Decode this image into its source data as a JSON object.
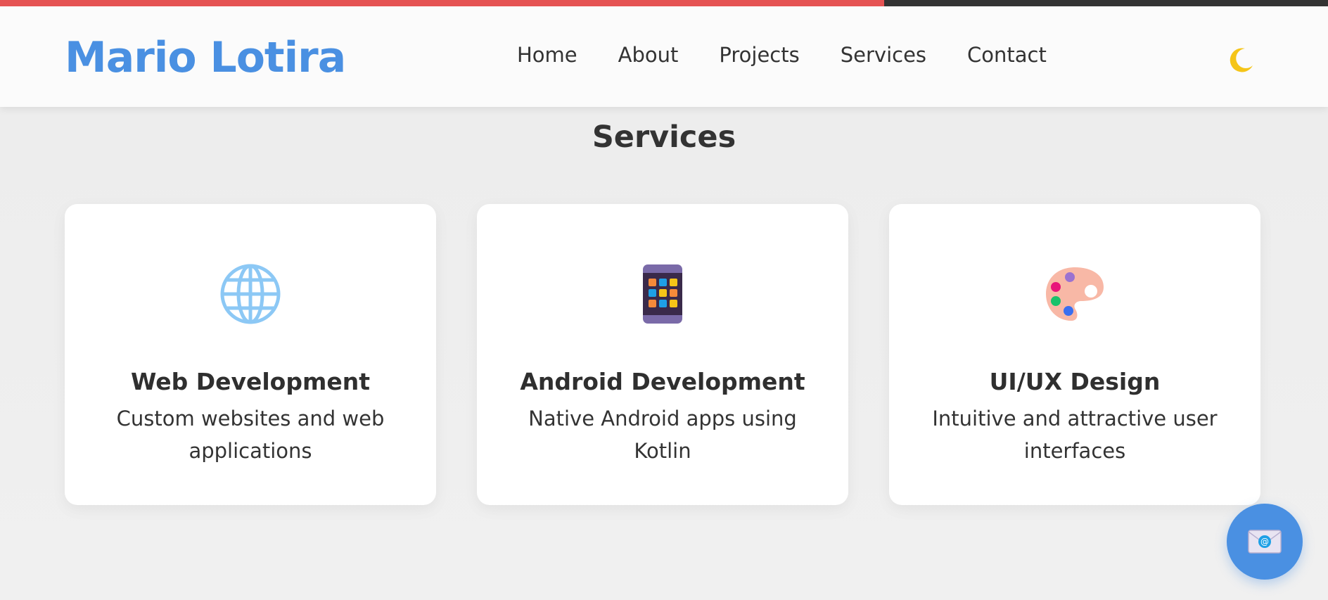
{
  "progress": {
    "fraction": 0.666
  },
  "header": {
    "logo": "Mario Lotira",
    "nav": [
      "Home",
      "About",
      "Projects",
      "Services",
      "Contact"
    ],
    "theme_toggle_icon": "crescent-moon-icon"
  },
  "services": {
    "title": "Services",
    "cards": [
      {
        "icon": "globe-icon",
        "title": "Web Development",
        "description": "Custom websites and web applications"
      },
      {
        "icon": "mobile-phone-icon",
        "title": "Android Development",
        "description": "Native Android apps using Kotlin"
      },
      {
        "icon": "artist-palette-icon",
        "title": "UI/UX Design",
        "description": "Intuitive and attractive user interfaces"
      }
    ]
  },
  "fab": {
    "icon": "envelope-icon"
  },
  "colors": {
    "accent": "#4a90e2",
    "progress": "#e55353",
    "progress_track": "#333333",
    "text": "#333333"
  }
}
